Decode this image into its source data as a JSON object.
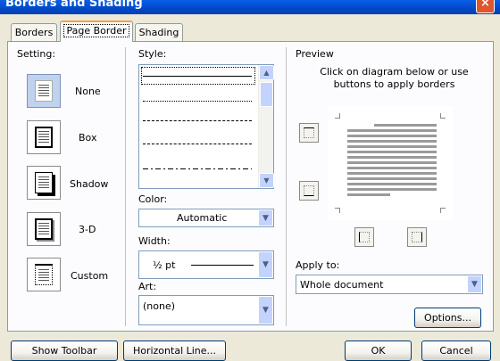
{
  "window": {
    "title": "Borders and Shading",
    "close_glyph": "×"
  },
  "tabs": [
    {
      "label": "Borders"
    },
    {
      "label": "Page Border"
    },
    {
      "label": "Shading"
    }
  ],
  "setting": {
    "heading": "Setting:",
    "options": [
      {
        "label": "None",
        "selected": true
      },
      {
        "label": "Box"
      },
      {
        "label": "Shadow"
      },
      {
        "label": "3-D"
      },
      {
        "label": "Custom"
      }
    ]
  },
  "style": {
    "heading": "Style:",
    "color_label": "Color:",
    "color_value": "Automatic",
    "width_label": "Width:",
    "width_value": "½ pt",
    "art_label": "Art:",
    "art_value": "(none)"
  },
  "preview": {
    "heading": "Preview",
    "instructions": "Click on diagram below or use buttons to apply borders",
    "apply_to_label": "Apply to:",
    "apply_to_value": "Whole document",
    "options_button": "Options..."
  },
  "footer": {
    "show_toolbar": "Show Toolbar",
    "horizontal_line": "Horizontal Line...",
    "ok": "OK",
    "cancel": "Cancel"
  },
  "colors": {
    "title_bar": "#0A5FE6",
    "dialog_bg": "#ECE9D8",
    "selected_setting": "#C1D2EE",
    "tab_highlight": "#F7A33B"
  }
}
